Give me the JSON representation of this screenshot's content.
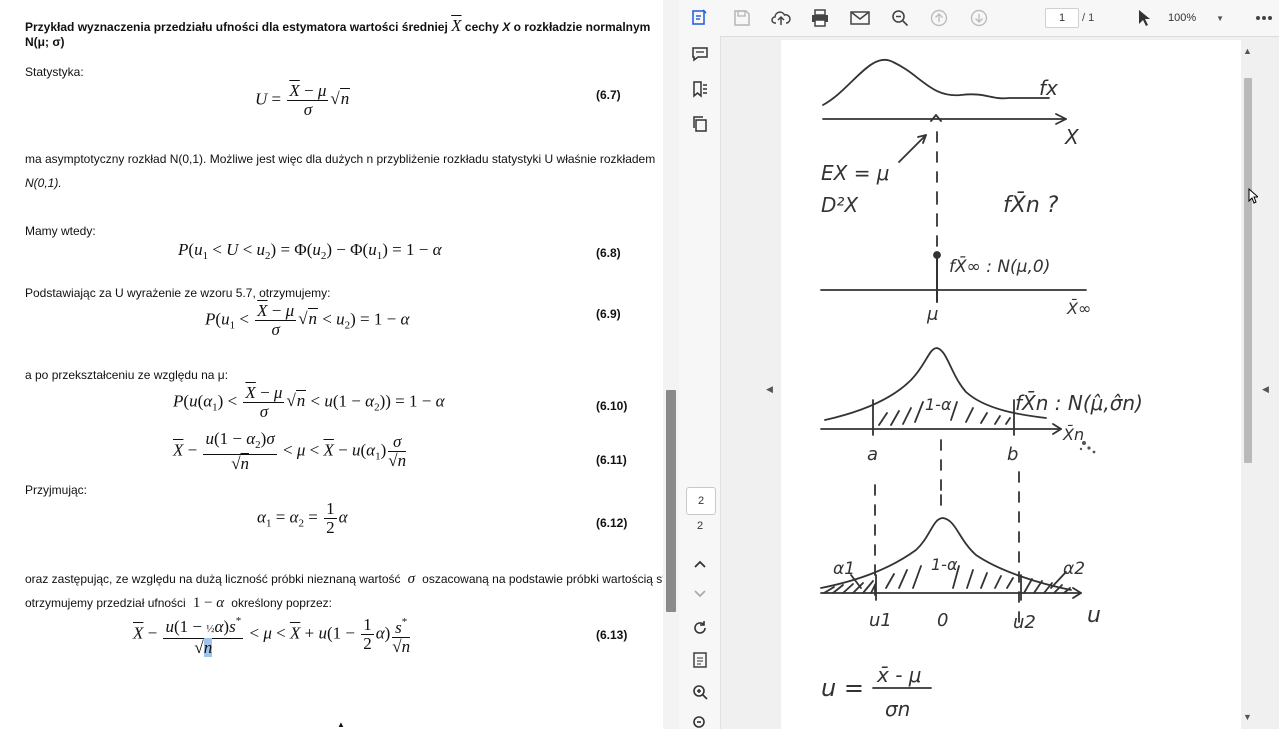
{
  "document": {
    "heading_line1": "Przykład wyznaczenia przedziału ufności dla estymatora wartości średniej",
    "heading_mid": "cechy",
    "heading_var": "X",
    "heading_end": "o rozkładzie normalnym",
    "heading_line2": "N(μ; σ)",
    "statystyka_label": "Statystyka:",
    "eq_6_7": "(6.7)",
    "p_asym_1": "ma asymptotyczny rozkład N(0,1). Możliwe jest więc dla dużych n przybliżenie rozkładu statystyki U właśnie rozkładem",
    "p_asym_2": "N(0,1).",
    "mamy_label": "Mamy wtedy:",
    "eq_6_8": "(6.8)",
    "podst_label": "Podstawiając za U wyrażenie ze wzoru 5.7, otrzymujemy:",
    "eq_6_9": "(6.9)",
    "po_label": "a po przekształceniu ze względu na μ:",
    "eq_6_10": "(6.10)",
    "eq_6_11": "(6.11)",
    "przyj_label": "Przyjmując:",
    "eq_6_12": "(6.12)",
    "oraz_1a": "oraz zastępując, ze względu na dużą liczność próbki nieznaną wartość",
    "oraz_1b": "oszacowaną na podstawie próbki wartością s*,",
    "oraz_2a": "otrzymujemy przedział ufności",
    "oraz_2b": "określony poprzez:",
    "eq_6_13": "(6.13)"
  },
  "toolbar": {
    "page_current": "1",
    "page_total": "/ 1",
    "zoom": "100%"
  },
  "sidebar_nav": {
    "page_box": "2",
    "page_total": "2"
  },
  "handwriting": {
    "fx": "fx",
    "x_axis": "X",
    "ex": "EX = μ",
    "d2x": "D²X",
    "fxn_q": "fX̄n ?",
    "finf": "fX̄∞ : N(μ,0)",
    "mu": "μ",
    "xinf": "X̄∞",
    "fxn_n": "fX̄n : N(μ̂,σ̂n)",
    "one_minus_a": "1-α",
    "a_lbl": "a",
    "b_lbl": "b",
    "xn_lbl": "X̄n",
    "alpha1": "α1",
    "alpha2": "α2",
    "u1": "u1",
    "zero": "0",
    "u2": "u2",
    "u_axis": "u",
    "u_eq": "u =",
    "u_num": "x̄ - μ",
    "u_den": "σn"
  }
}
